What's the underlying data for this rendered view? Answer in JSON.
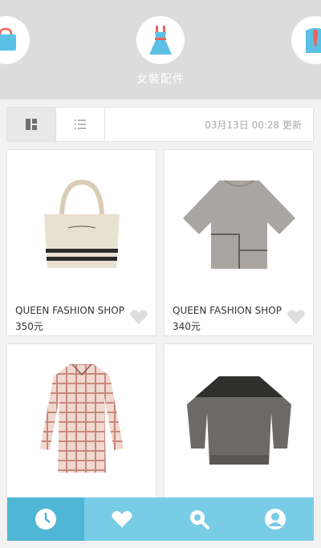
{
  "categories": {
    "current_label": "女裝配件",
    "items": [
      {
        "icon": "shopping-bag-icon"
      },
      {
        "icon": "dress-icon"
      },
      {
        "icon": "shirt-tie-icon"
      }
    ]
  },
  "toolbar": {
    "grid_view_icon": "grid-view-icon",
    "list_view_icon": "list-view-icon",
    "update_time": "03月13日 00:28 更新"
  },
  "products": [
    {
      "shop": "QUEEN FASHION SHOP",
      "price": "350元",
      "image": "tote-bag"
    },
    {
      "shop": "QUEEN FASHION SHOP",
      "price": "340元",
      "image": "grey-top"
    },
    {
      "shop": "",
      "price": "",
      "image": "plaid-shirt"
    },
    {
      "shop": "",
      "price": "",
      "image": "sweater"
    }
  ],
  "bottom_nav": [
    {
      "icon": "clock-icon",
      "active": true
    },
    {
      "icon": "heart-icon",
      "active": false
    },
    {
      "icon": "search-icon",
      "active": false
    },
    {
      "icon": "profile-icon",
      "active": false
    }
  ],
  "colors": {
    "nav_bg": "#79cce6",
    "nav_active": "#4fb6d6",
    "accent_icon": "#4db8e0"
  }
}
